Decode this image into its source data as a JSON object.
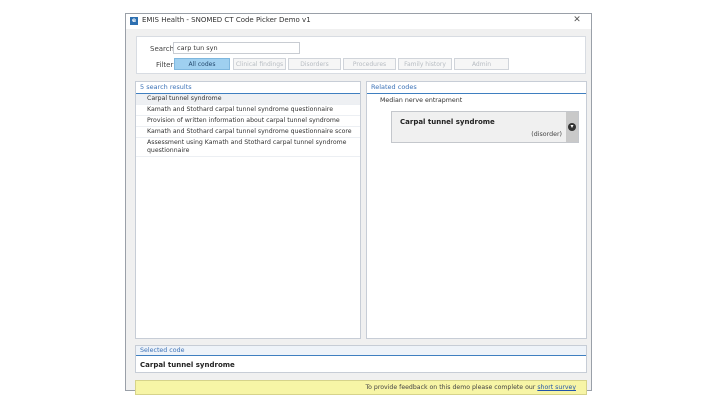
{
  "window": {
    "app_icon": "app-logo-icon",
    "title": "EMIS Health - SNOMED CT Code Picker Demo v1",
    "close_label": "✕"
  },
  "search": {
    "label": "Search",
    "value": "carp tun syn"
  },
  "filter": {
    "label": "Filter",
    "buttons": [
      {
        "label": "All codes",
        "active": true
      },
      {
        "label": "Clinical findings",
        "active": false
      },
      {
        "label": "Disorders",
        "active": false
      },
      {
        "label": "Procedures",
        "active": false
      },
      {
        "label": "Family history",
        "active": false
      },
      {
        "label": "Admin",
        "active": false
      }
    ]
  },
  "results": {
    "header": "5 search results",
    "items": [
      "Carpal tunnel syndrome",
      "Kamath and Stothard carpal tunnel syndrome questionnaire",
      "Provision of written information about carpal tunnel syndrome",
      "Kamath and Stothard carpal tunnel syndrome questionnaire score",
      "Assessment using Kamath and Stothard carpal tunnel syndrome questionnaire"
    ]
  },
  "related": {
    "header": "Related codes",
    "parent": "Median nerve entrapment",
    "card": {
      "title": "Carpal tunnel syndrome",
      "tag": "(disorder)",
      "arrow_icon": "chevron-down-icon"
    }
  },
  "selected": {
    "header": "Selected code",
    "value": "Carpal tunnel syndrome"
  },
  "feedback": {
    "text": "To provide feedback on this demo please complete our",
    "link": "short survey"
  },
  "colors": {
    "accent": "#3f7fc0",
    "filter_active": "#9fd0f0",
    "feedback_bg": "#f7f5a6"
  }
}
